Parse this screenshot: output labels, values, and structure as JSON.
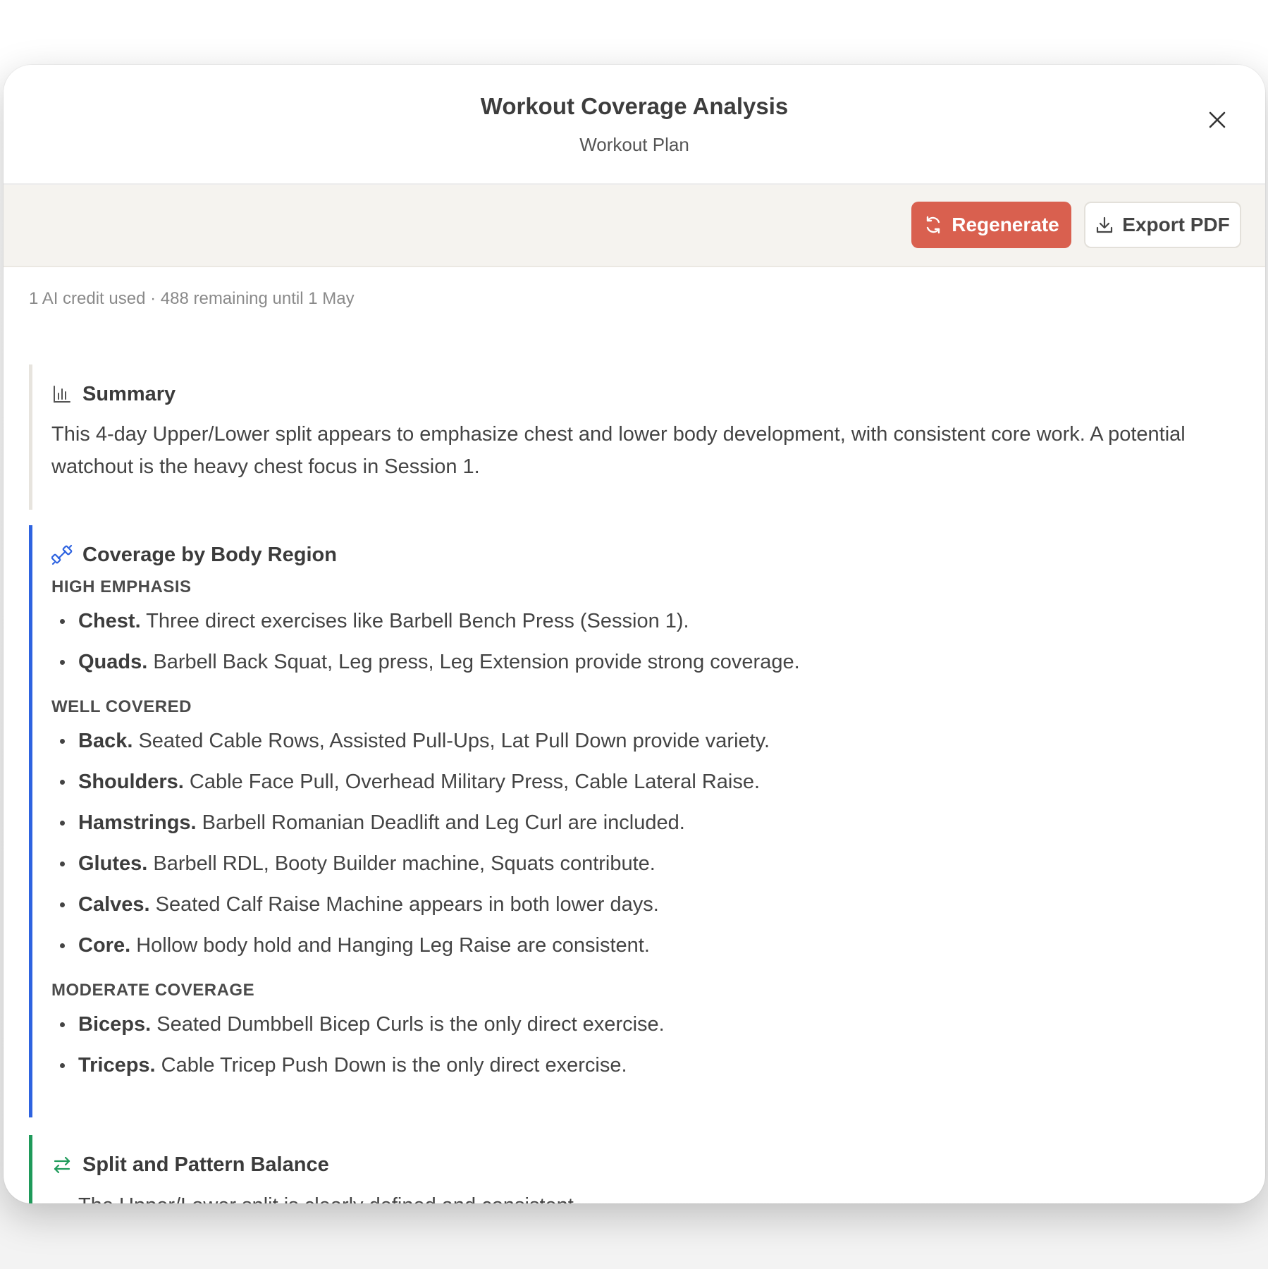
{
  "modal": {
    "title": "Workout Coverage Analysis",
    "subtitle": "Workout Plan",
    "close_icon": "close-icon"
  },
  "toolbar": {
    "regenerate_label": "Regenerate",
    "regenerate_icon": "refresh-icon",
    "export_label": "Export PDF",
    "export_icon": "download-icon"
  },
  "credits": "1 AI credit used · 488 remaining until 1 May",
  "summary": {
    "icon": "bar-chart-icon",
    "heading": "Summary",
    "text": "This 4-day Upper/Lower split appears to emphasize chest and lower body development, with consistent core work. A potential watchout is the heavy chest focus in Session 1."
  },
  "coverage": {
    "icon": "dumbbell-icon",
    "heading": "Coverage by Body Region",
    "groups": [
      {
        "label": "HIGH EMPHASIS",
        "items": [
          {
            "name": "Chest.",
            "text": " Three direct exercises like Barbell Bench Press (Session 1)."
          },
          {
            "name": "Quads.",
            "text": " Barbell Back Squat, Leg press, Leg Extension provide strong coverage."
          }
        ]
      },
      {
        "label": "WELL COVERED",
        "items": [
          {
            "name": "Back.",
            "text": " Seated Cable Rows, Assisted Pull-Ups, Lat Pull Down provide variety."
          },
          {
            "name": "Shoulders.",
            "text": " Cable Face Pull, Overhead Military Press, Cable Lateral Raise."
          },
          {
            "name": "Hamstrings.",
            "text": " Barbell Romanian Deadlift and Leg Curl are included."
          },
          {
            "name": "Glutes.",
            "text": " Barbell RDL, Booty Builder machine, Squats contribute."
          },
          {
            "name": "Calves.",
            "text": " Seated Calf Raise Machine appears in both lower days."
          },
          {
            "name": "Core.",
            "text": " Hollow body hold and Hanging Leg Raise are consistent."
          }
        ]
      },
      {
        "label": "MODERATE COVERAGE",
        "items": [
          {
            "name": "Biceps.",
            "text": " Seated Dumbbell Bicep Curls is the only direct exercise."
          },
          {
            "name": "Triceps.",
            "text": " Cable Tricep Push Down is the only direct exercise."
          }
        ]
      }
    ]
  },
  "split": {
    "icon": "swap-arrows-icon",
    "heading": "Split and Pattern Balance",
    "first_item": "The Upper/Lower split is clearly defined and consistent."
  },
  "colors": {
    "accent_button": "#d9604f",
    "coverage_bar": "#2e63e0",
    "split_bar": "#1f9a5a",
    "summary_bar": "#e7e4de"
  }
}
